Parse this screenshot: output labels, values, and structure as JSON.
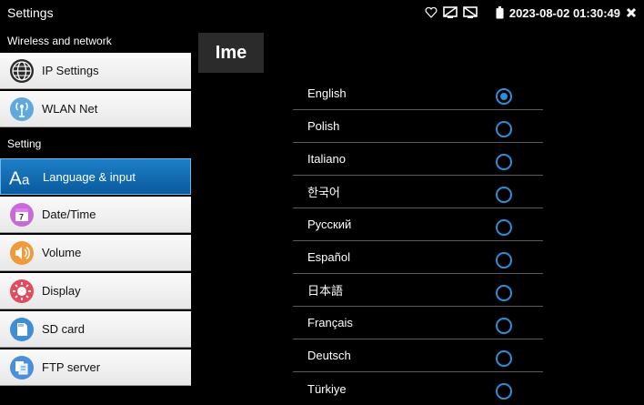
{
  "status_bar": {
    "app_title": "Settings",
    "datetime": "2023-08-02 01:30:49"
  },
  "sidebar": {
    "sections": [
      {
        "header": "Wireless and network",
        "items": [
          {
            "label": "IP Settings",
            "icon": "globe-icon"
          },
          {
            "label": "WLAN Net",
            "icon": "wifi-antenna-icon"
          }
        ]
      },
      {
        "header": "Setting",
        "items": [
          {
            "label": "Language & input",
            "icon": "language-icon",
            "active": true
          },
          {
            "label": "Date/Time",
            "icon": "calendar-icon"
          },
          {
            "label": "Volume",
            "icon": "volume-icon"
          },
          {
            "label": "Display",
            "icon": "display-brightness-icon"
          },
          {
            "label": "SD card",
            "icon": "sd-card-icon"
          },
          {
            "label": "FTP server",
            "icon": "ftp-server-icon"
          }
        ]
      }
    ]
  },
  "main": {
    "tab_label": "Ime",
    "languages": [
      {
        "label": "English",
        "selected": true
      },
      {
        "label": "Polish",
        "selected": false
      },
      {
        "label": "Italiano",
        "selected": false
      },
      {
        "label": "한국어",
        "selected": false
      },
      {
        "label": "Русский",
        "selected": false
      },
      {
        "label": "Español",
        "selected": false
      },
      {
        "label": "日本語",
        "selected": false
      },
      {
        "label": "Français",
        "selected": false
      },
      {
        "label": "Deutsch",
        "selected": false
      },
      {
        "label": "Türkiye",
        "selected": false
      }
    ]
  },
  "colors": {
    "accent": "#2e8fd8",
    "active_item": "#1470b8"
  }
}
